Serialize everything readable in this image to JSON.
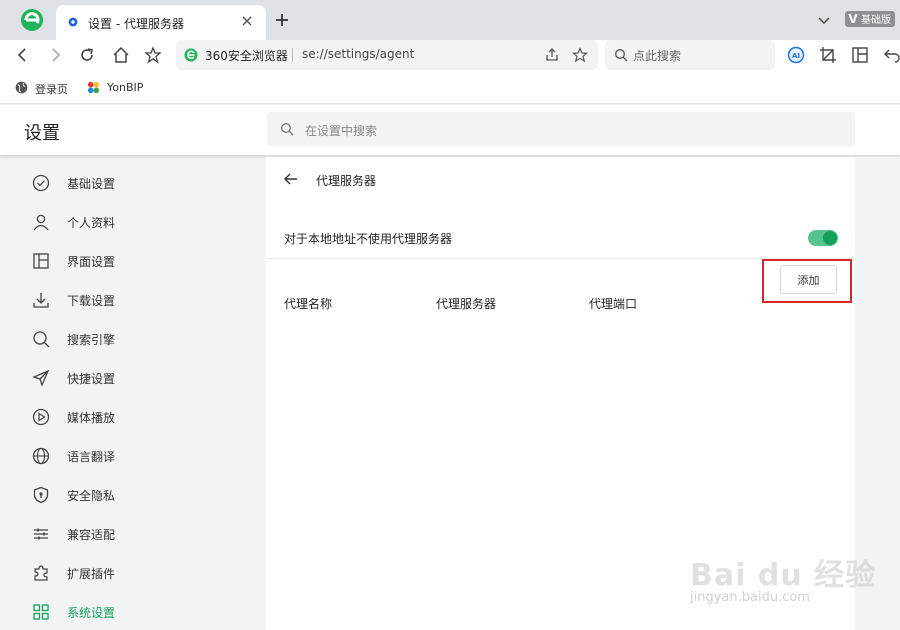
{
  "colors": {
    "accent": "#16a05d",
    "highlight": "#d7282c",
    "toggle_on": "#56c28c"
  },
  "tab": {
    "title": "设置 - 代理服务器",
    "icon": "gear-icon"
  },
  "edition": {
    "mark": "V",
    "label": "基础版"
  },
  "address_bar": {
    "site_name": "360安全浏览器",
    "url": "se://settings/agent"
  },
  "toolbar_search": {
    "placeholder": "点此搜索"
  },
  "bookmarks": [
    {
      "label": "登录页",
      "icon": "globe-icon"
    },
    {
      "label": "YonBIP",
      "icon": "yonbip-logo-icon"
    }
  ],
  "settings": {
    "title": "设置",
    "search_placeholder": "在设置中搜索"
  },
  "sidebar": {
    "items": [
      {
        "label": "基础设置",
        "icon": "check-circle-icon"
      },
      {
        "label": "个人资料",
        "icon": "person-icon"
      },
      {
        "label": "界面设置",
        "icon": "layout-icon"
      },
      {
        "label": "下载设置",
        "icon": "download-icon"
      },
      {
        "label": "搜索引擎",
        "icon": "search-icon"
      },
      {
        "label": "快捷设置",
        "icon": "send-icon"
      },
      {
        "label": "媒体播放",
        "icon": "play-icon"
      },
      {
        "label": "语言翻译",
        "icon": "globe-icon"
      },
      {
        "label": "安全隐私",
        "icon": "shield-icon"
      },
      {
        "label": "兼容适配",
        "icon": "sliders-icon"
      },
      {
        "label": "扩展插件",
        "icon": "puzzle-icon"
      },
      {
        "label": "系统设置",
        "icon": "grid-icon",
        "active": true
      }
    ]
  },
  "proxy": {
    "title": "代理服务器",
    "bypass_local_label": "对于本地地址不使用代理服务器",
    "bypass_local_enabled": true,
    "add_button": "添加",
    "columns": [
      "代理名称",
      "代理服务器",
      "代理端口"
    ]
  },
  "watermark": {
    "text": "Bai du 经验",
    "sub": "jingyan.baidu.com"
  }
}
